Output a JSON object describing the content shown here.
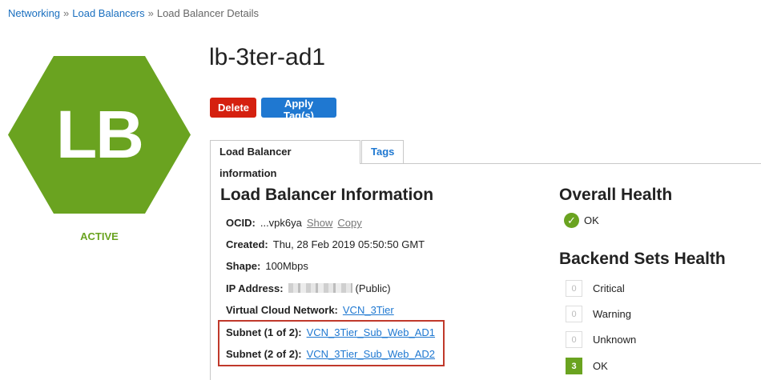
{
  "breadcrumb": {
    "items": [
      "Networking",
      "Load Balancers"
    ],
    "separator": "»",
    "current": "Load Balancer Details"
  },
  "resource": {
    "icon_text": "LB",
    "status": "ACTIVE",
    "name": "lb-3ter-ad1",
    "icon_color": "#6aa320"
  },
  "actions": {
    "delete_label": "Delete",
    "apply_tags_label": "Apply Tag(s)"
  },
  "tabs": [
    {
      "label": "Load Balancer information",
      "active": true
    },
    {
      "label": "Tags",
      "active": false
    }
  ],
  "info": {
    "heading": "Load Balancer Information",
    "ocid_label": "OCID:",
    "ocid_value": "...vpk6ya",
    "show_label": "Show",
    "copy_label": "Copy",
    "created_label": "Created:",
    "created_value": "Thu, 28 Feb 2019 05:50:50 GMT",
    "shape_label": "Shape:",
    "shape_value": "100Mbps",
    "ip_label": "IP Address:",
    "ip_suffix": "(Public)",
    "vcn_label": "Virtual Cloud Network:",
    "vcn_value": "VCN_3Tier",
    "subnet1_label": "Subnet (1 of 2):",
    "subnet1_value": "VCN_3Tier_Sub_Web_AD1",
    "subnet2_label": "Subnet (2 of 2):",
    "subnet2_value": "VCN_3Tier_Sub_Web_AD2"
  },
  "overall_health": {
    "heading": "Overall Health",
    "status": "OK"
  },
  "backend_health": {
    "heading": "Backend Sets Health",
    "rows": [
      {
        "label": "Critical",
        "count": "0"
      },
      {
        "label": "Warning",
        "count": "0"
      },
      {
        "label": "Unknown",
        "count": "0"
      },
      {
        "label": "OK",
        "count": "3"
      }
    ]
  }
}
